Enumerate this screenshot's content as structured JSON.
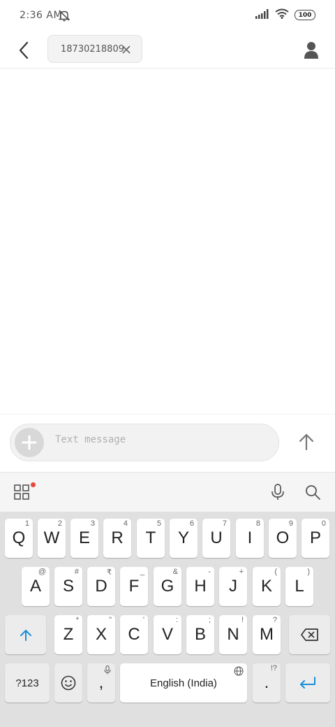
{
  "status_bar": {
    "time": "2:36 AM",
    "battery": "100"
  },
  "header": {
    "recipient": "18730218809"
  },
  "compose": {
    "placeholder": "Text message"
  },
  "keyboard": {
    "row1": [
      {
        "label": "Q",
        "hint": "1"
      },
      {
        "label": "W",
        "hint": "2"
      },
      {
        "label": "E",
        "hint": "3"
      },
      {
        "label": "R",
        "hint": "4"
      },
      {
        "label": "T",
        "hint": "5"
      },
      {
        "label": "Y",
        "hint": "6"
      },
      {
        "label": "U",
        "hint": "7"
      },
      {
        "label": "I",
        "hint": "8"
      },
      {
        "label": "O",
        "hint": "9"
      },
      {
        "label": "P",
        "hint": "0"
      }
    ],
    "row2": [
      {
        "label": "A",
        "hint": "@"
      },
      {
        "label": "S",
        "hint": "#"
      },
      {
        "label": "D",
        "hint": "₹"
      },
      {
        "label": "F",
        "hint": "_"
      },
      {
        "label": "G",
        "hint": "&"
      },
      {
        "label": "H",
        "hint": "-"
      },
      {
        "label": "J",
        "hint": "+"
      },
      {
        "label": "K",
        "hint": "("
      },
      {
        "label": "L",
        "hint": ")"
      }
    ],
    "row3": [
      {
        "label": "Z",
        "hint": "*"
      },
      {
        "label": "X",
        "hint": "\""
      },
      {
        "label": "C",
        "hint": "'"
      },
      {
        "label": "V",
        "hint": ":"
      },
      {
        "label": "B",
        "hint": ";"
      },
      {
        "label": "N",
        "hint": "!"
      },
      {
        "label": "M",
        "hint": "?"
      }
    ],
    "symbols_label": "?123",
    "comma_label": ",",
    "space_label": "English (India)",
    "period_label": ".",
    "period_hint": "!?"
  },
  "icons": {
    "back": "back-arrow-icon",
    "close": "close-icon",
    "contact": "person-icon",
    "plus": "plus-icon",
    "send": "send-arrow-icon",
    "apps": "grid-icon",
    "mic": "mic-icon",
    "search": "search-icon",
    "shift": "shift-icon",
    "backspace": "backspace-icon",
    "emoji": "emoji-icon",
    "globe": "globe-icon",
    "enter": "enter-icon"
  },
  "colors": {
    "accent": "#1a8fd6",
    "notification_dot": "#e8453c",
    "keyboard_bg": "#e0e0e0"
  }
}
